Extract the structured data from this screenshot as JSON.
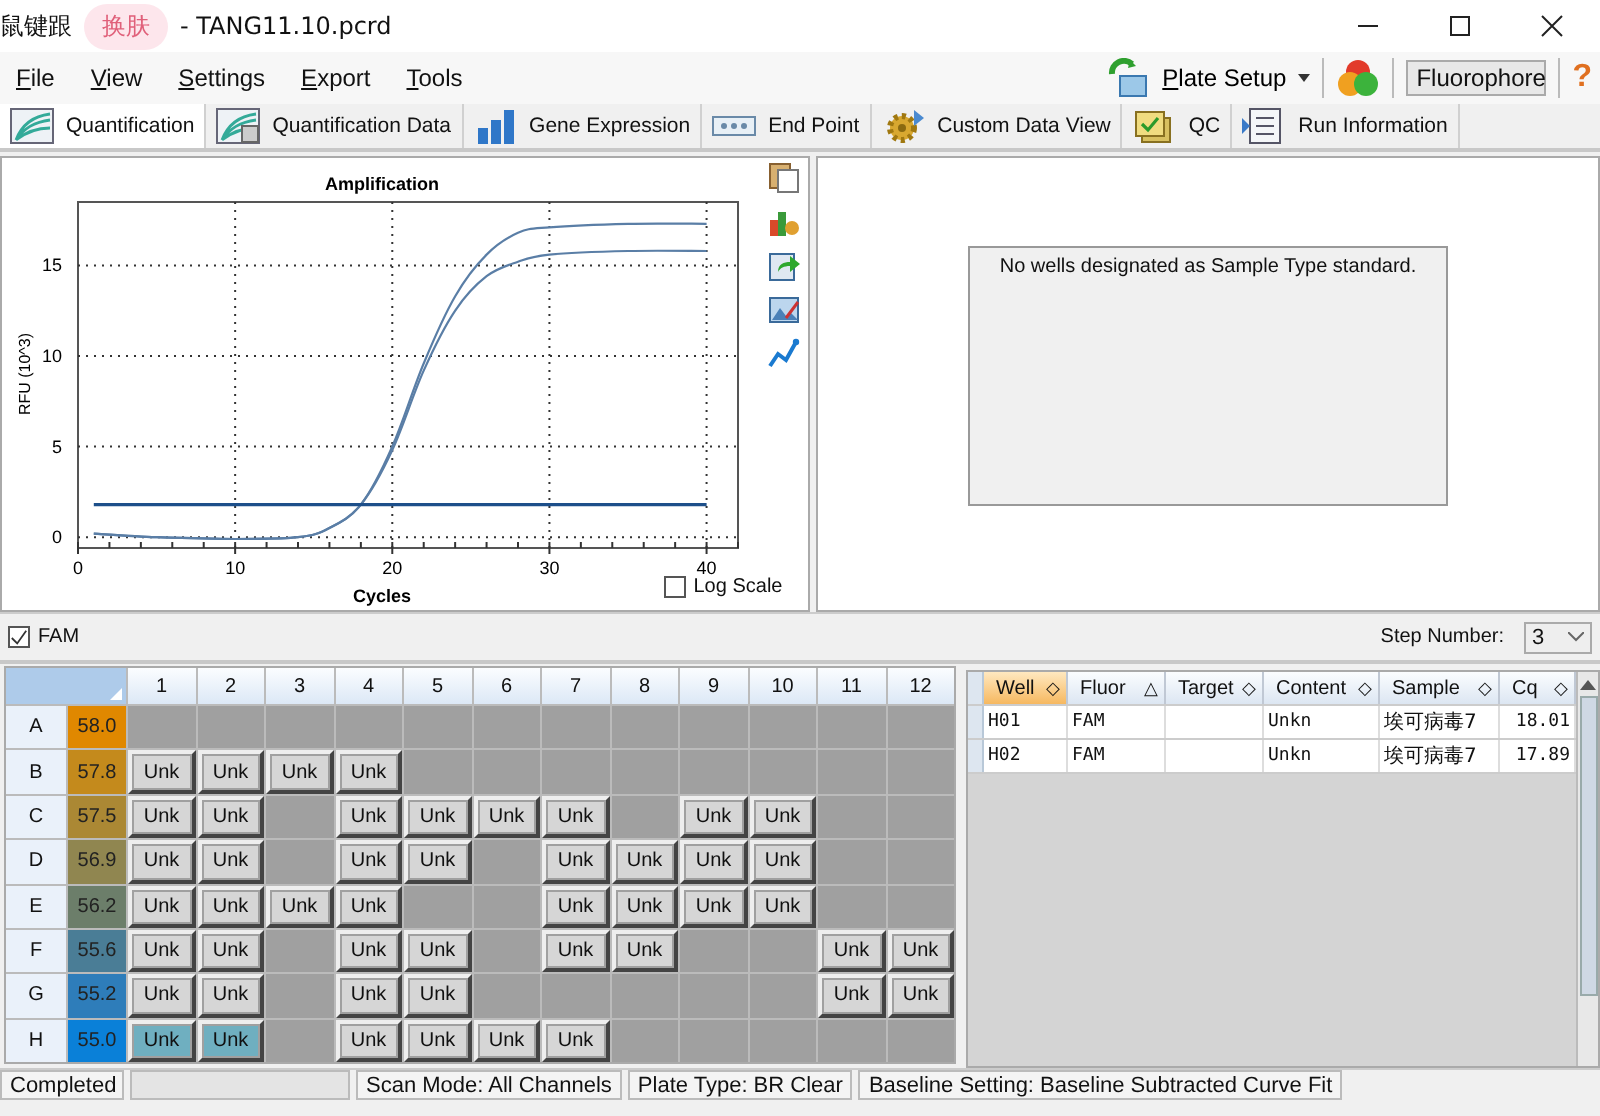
{
  "window": {
    "title_left": "鼠键跟",
    "badge": "换肤",
    "title_right": "- TANG11.10.pcrd"
  },
  "menu": [
    "File",
    "View",
    "Settings",
    "Export",
    "Tools"
  ],
  "toolbar": {
    "plate_setup": "Plate Setup",
    "fluorophore": "Fluorophore",
    "help": "?"
  },
  "tabs": [
    {
      "label": "Quantification",
      "selected": true
    },
    {
      "label": "Quantification Data",
      "selected": false
    },
    {
      "label": "Gene Expression",
      "selected": false
    },
    {
      "label": "End Point",
      "selected": false
    },
    {
      "label": "Custom Data View",
      "selected": false
    },
    {
      "label": "QC",
      "selected": false
    },
    {
      "label": "Run Information",
      "selected": false
    }
  ],
  "chart": {
    "log_scale": {
      "label": "Log Scale",
      "checked": false
    },
    "chart_data": {
      "type": "line",
      "grid": true,
      "title": "Amplification",
      "xlabel": "Cycles",
      "ylabel": "RFU (10^3)",
      "x": [
        1,
        5,
        10,
        14,
        16,
        18,
        20,
        22,
        24,
        26,
        28,
        30,
        35,
        40
      ],
      "xlim": [
        0,
        42
      ],
      "ylim": [
        -0.6,
        18.5
      ],
      "xticks": [
        0,
        10,
        20,
        30,
        40
      ],
      "yticks": [
        0,
        5,
        10,
        15
      ],
      "series": [
        {
          "color": "#5a7ea6",
          "values": [
            0.2,
            0,
            -0.1,
            0,
            0.5,
            1.8,
            5,
            9.6,
            13.3,
            15.6,
            16.8,
            17.1,
            17.3,
            17.3
          ]
        },
        {
          "color": "#5a7ea6",
          "values": [
            0.2,
            0,
            -0.1,
            0,
            0.5,
            1.8,
            4.8,
            9.2,
            12.5,
            14.4,
            15.2,
            15.6,
            15.8,
            15.8
          ]
        },
        {
          "color": "#1d4f8a",
          "values": [
            1.8,
            1.8,
            1.8,
            1.8,
            1.8,
            1.8,
            1.8,
            1.8,
            1.8,
            1.8,
            1.8,
            1.8,
            1.8,
            1.8
          ]
        }
      ]
    }
  },
  "standard_message": "No wells designated as Sample Type standard.",
  "fluor_filter": {
    "label": "FAM",
    "checked": true
  },
  "step": {
    "label": "Step Number:",
    "value": "3"
  },
  "plate": {
    "columns": [
      "1",
      "2",
      "3",
      "4",
      "5",
      "6",
      "7",
      "8",
      "9",
      "10",
      "11",
      "12"
    ],
    "rows": [
      {
        "label": "A",
        "temp": "58.0",
        "color": "#e08800",
        "wells": [
          {
            "selected": false
          },
          {
            "selected": false
          },
          {
            "selected": false
          },
          {
            "selected": false
          },
          {
            "selected": false
          },
          {
            "selected": false
          },
          {
            "selected": false
          },
          {
            "selected": false
          },
          {
            "selected": false
          },
          {
            "selected": false
          },
          {
            "selected": false
          },
          {
            "selected": false
          }
        ]
      },
      {
        "label": "B",
        "temp": "57.8",
        "color": "#c48a1c",
        "wells": [
          {
            "content": "Unk",
            "selected": false
          },
          {
            "content": "Unk",
            "selected": false
          },
          {
            "content": "Unk",
            "selected": false
          },
          {
            "content": "Unk",
            "selected": false
          },
          {
            "selected": false
          },
          {
            "selected": false
          },
          {
            "selected": false
          },
          {
            "selected": false
          },
          {
            "selected": false
          },
          {
            "selected": false
          },
          {
            "selected": false
          },
          {
            "selected": false
          }
        ]
      },
      {
        "label": "C",
        "temp": "57.5",
        "color": "#ab8834",
        "wells": [
          {
            "content": "Unk",
            "selected": false
          },
          {
            "content": "Unk",
            "selected": false
          },
          {
            "selected": false
          },
          {
            "content": "Unk",
            "selected": false
          },
          {
            "content": "Unk",
            "selected": false
          },
          {
            "content": "Unk",
            "selected": false
          },
          {
            "content": "Unk",
            "selected": false
          },
          {
            "selected": false
          },
          {
            "content": "Unk",
            "selected": false
          },
          {
            "content": "Unk",
            "selected": false
          },
          {
            "selected": false
          },
          {
            "selected": false
          }
        ]
      },
      {
        "label": "D",
        "temp": "56.9",
        "color": "#908650",
        "wells": [
          {
            "content": "Unk",
            "selected": false
          },
          {
            "content": "Unk",
            "selected": false
          },
          {
            "selected": false
          },
          {
            "content": "Unk",
            "selected": false
          },
          {
            "content": "Unk",
            "selected": false
          },
          {
            "selected": false
          },
          {
            "content": "Unk",
            "selected": false
          },
          {
            "content": "Unk",
            "selected": false
          },
          {
            "content": "Unk",
            "selected": false
          },
          {
            "content": "Unk",
            "selected": false
          },
          {
            "selected": false
          },
          {
            "selected": false
          }
        ]
      },
      {
        "label": "E",
        "temp": "56.2",
        "color": "#6c7e6a",
        "wells": [
          {
            "content": "Unk",
            "selected": false
          },
          {
            "content": "Unk",
            "selected": false
          },
          {
            "content": "Unk",
            "selected": false
          },
          {
            "content": "Unk",
            "selected": false
          },
          {
            "selected": false
          },
          {
            "selected": false
          },
          {
            "content": "Unk",
            "selected": false
          },
          {
            "content": "Unk",
            "selected": false
          },
          {
            "content": "Unk",
            "selected": false
          },
          {
            "content": "Unk",
            "selected": false
          },
          {
            "selected": false
          },
          {
            "selected": false
          }
        ]
      },
      {
        "label": "F",
        "temp": "55.6",
        "color": "#4a7d96",
        "wells": [
          {
            "content": "Unk",
            "selected": false
          },
          {
            "content": "Unk",
            "selected": false
          },
          {
            "selected": false
          },
          {
            "content": "Unk",
            "selected": false
          },
          {
            "content": "Unk",
            "selected": false
          },
          {
            "selected": false
          },
          {
            "content": "Unk",
            "selected": false
          },
          {
            "content": "Unk",
            "selected": false
          },
          {
            "selected": false
          },
          {
            "selected": false
          },
          {
            "content": "Unk",
            "selected": false
          },
          {
            "content": "Unk",
            "selected": false
          }
        ]
      },
      {
        "label": "G",
        "temp": "55.2",
        "color": "#2e7dba",
        "wells": [
          {
            "content": "Unk",
            "selected": false
          },
          {
            "content": "Unk",
            "selected": false
          },
          {
            "selected": false
          },
          {
            "content": "Unk",
            "selected": false
          },
          {
            "content": "Unk",
            "selected": false
          },
          {
            "selected": false
          },
          {
            "selected": false
          },
          {
            "selected": false
          },
          {
            "selected": false
          },
          {
            "selected": false
          },
          {
            "content": "Unk",
            "selected": false
          },
          {
            "content": "Unk",
            "selected": false
          }
        ]
      },
      {
        "label": "H",
        "temp": "55.0",
        "color": "#0a80d8",
        "wells": [
          {
            "content": "Unk",
            "selected": true
          },
          {
            "content": "Unk",
            "selected": true
          },
          {
            "selected": false
          },
          {
            "content": "Unk",
            "selected": false
          },
          {
            "content": "Unk",
            "selected": false
          },
          {
            "content": "Unk",
            "selected": false
          },
          {
            "content": "Unk",
            "selected": false
          },
          {
            "selected": false
          },
          {
            "selected": false
          },
          {
            "selected": false
          },
          {
            "selected": false
          },
          {
            "selected": false
          }
        ]
      }
    ]
  },
  "results": {
    "columns": [
      {
        "label": "Well",
        "sort_icon": "◇",
        "selected": true
      },
      {
        "label": "Fluor",
        "sort_icon": "△",
        "selected": false
      },
      {
        "label": "Target",
        "sort_icon": "◇",
        "selected": false
      },
      {
        "label": "Content",
        "sort_icon": "◇",
        "selected": false
      },
      {
        "label": "Sample",
        "sort_icon": "◇",
        "selected": false
      },
      {
        "label": "Cq",
        "sort_icon": "◇",
        "selected": false
      }
    ],
    "rows": [
      [
        "H01",
        "FAM",
        "",
        "Unkn",
        "埃可病毒7",
        "18.01"
      ],
      [
        "H02",
        "FAM",
        "",
        "Unkn",
        "埃可病毒7",
        "17.89"
      ]
    ]
  },
  "status_bar": [
    "Completed",
    "Scan Mode: All Channels",
    "Plate Type: BR Clear",
    "Baseline Setting: Baseline Subtracted Curve Fit"
  ]
}
